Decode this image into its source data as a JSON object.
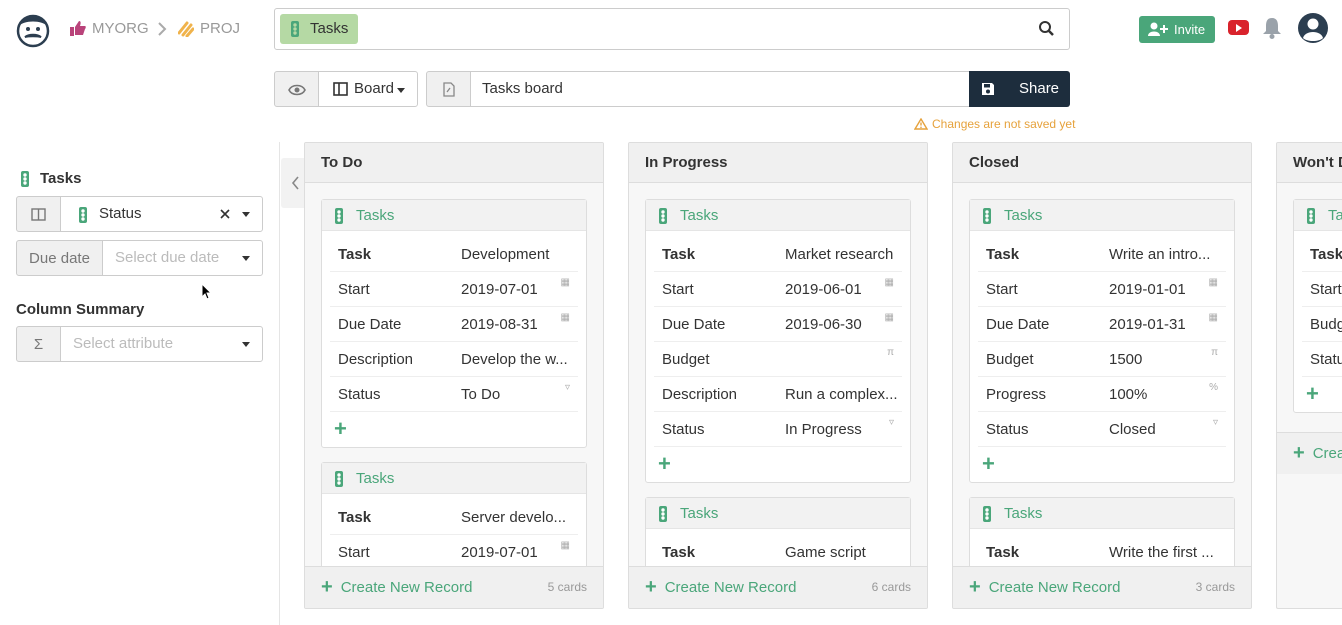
{
  "header": {
    "org": "MYORG",
    "project": "PROJ",
    "search_chip": "Tasks",
    "invite_label": "Invite"
  },
  "toolbar": {
    "view_label": "Board",
    "view_name": "Tasks board",
    "share_label": "Share",
    "unsaved_notice": "Changes are not saved yet"
  },
  "sidebar": {
    "title": "Tasks",
    "group_by": "Status",
    "due_date_label": "Due date",
    "due_date_placeholder": "Select due date",
    "summary_title": "Column Summary",
    "summary_placeholder": "Select attribute",
    "sigma": "Σ"
  },
  "columns": [
    {
      "title": "To Do",
      "create_label": "Create New Record",
      "count": "5 cards",
      "cards": [
        {
          "collection": "Tasks",
          "rows": [
            {
              "k": "Task",
              "v": "Development"
            },
            {
              "k": "Start",
              "v": "2019-07-01"
            },
            {
              "k": "Due Date",
              "v": "2019-08-31"
            },
            {
              "k": "Description",
              "v": "Develop the w..."
            },
            {
              "k": "Status",
              "v": "To Do"
            }
          ]
        },
        {
          "collection": "Tasks",
          "rows": [
            {
              "k": "Task",
              "v": "Server develo..."
            },
            {
              "k": "Start",
              "v": "2019-07-01"
            }
          ]
        }
      ]
    },
    {
      "title": "In Progress",
      "create_label": "Create New Record",
      "count": "6 cards",
      "cards": [
        {
          "collection": "Tasks",
          "rows": [
            {
              "k": "Task",
              "v": "Market research"
            },
            {
              "k": "Start",
              "v": "2019-06-01"
            },
            {
              "k": "Due Date",
              "v": "2019-06-30"
            },
            {
              "k": "Budget",
              "v": ""
            },
            {
              "k": "Description",
              "v": "Run a complex..."
            },
            {
              "k": "Status",
              "v": "In Progress"
            }
          ]
        },
        {
          "collection": "Tasks",
          "rows": [
            {
              "k": "Task",
              "v": "Game script"
            }
          ]
        }
      ]
    },
    {
      "title": "Closed",
      "create_label": "Create New Record",
      "count": "3 cards",
      "cards": [
        {
          "collection": "Tasks",
          "rows": [
            {
              "k": "Task",
              "v": "Write an intro..."
            },
            {
              "k": "Start",
              "v": "2019-01-01"
            },
            {
              "k": "Due Date",
              "v": "2019-01-31"
            },
            {
              "k": "Budget",
              "v": "1500"
            },
            {
              "k": "Progress",
              "v": "100%"
            },
            {
              "k": "Status",
              "v": "Closed"
            }
          ]
        },
        {
          "collection": "Tasks",
          "rows": [
            {
              "k": "Task",
              "v": "Write the first ..."
            }
          ]
        }
      ]
    },
    {
      "title": "Won't D",
      "create_label": "Crea",
      "cards": [
        {
          "collection": "Ta",
          "rows": [
            {
              "k": "Task",
              "v": ""
            },
            {
              "k": "Start",
              "v": ""
            },
            {
              "k": "Budg",
              "v": ""
            },
            {
              "k": "Statu",
              "v": ""
            }
          ]
        }
      ]
    }
  ]
}
